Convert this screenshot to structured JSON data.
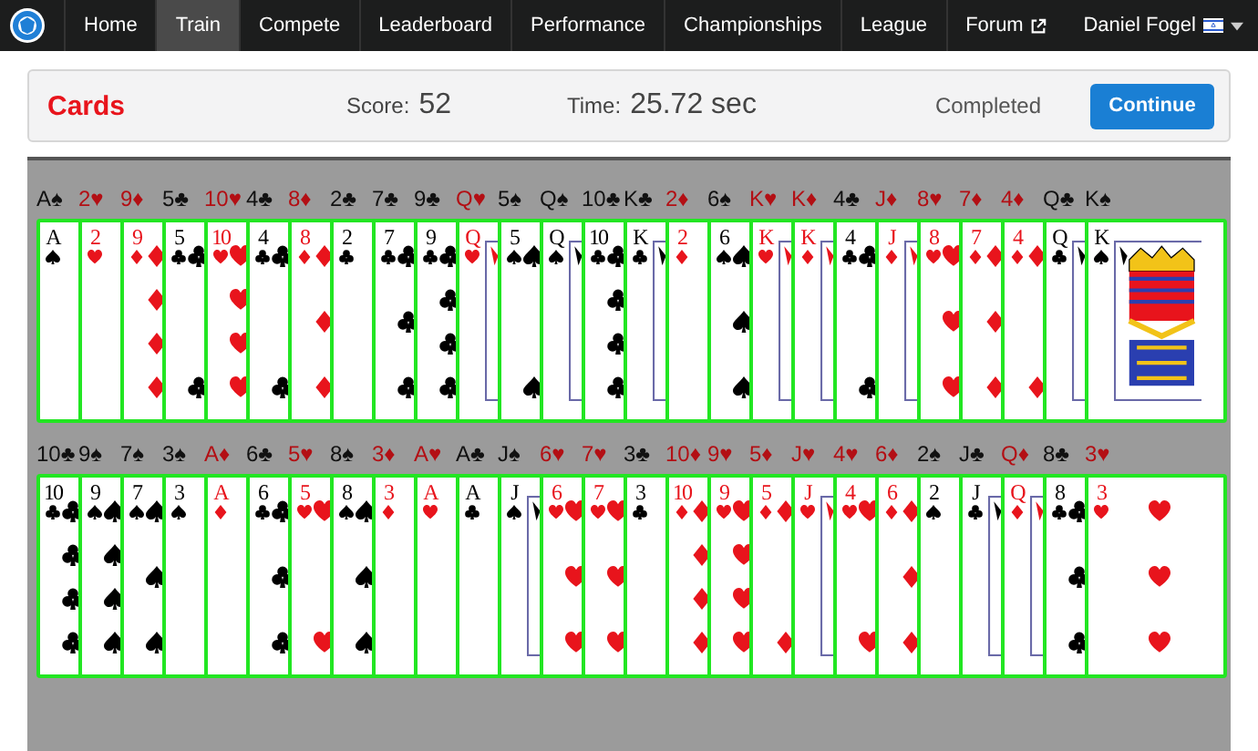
{
  "nav": {
    "items": [
      {
        "label": "Home",
        "selected": false
      },
      {
        "label": "Train",
        "selected": true
      },
      {
        "label": "Compete",
        "selected": false
      },
      {
        "label": "Leaderboard",
        "selected": false
      },
      {
        "label": "Performance",
        "selected": false
      },
      {
        "label": "Championships",
        "selected": false
      },
      {
        "label": "League",
        "selected": false
      },
      {
        "label": "Forum",
        "selected": false,
        "external": true
      }
    ],
    "user": "Daniel Fogel"
  },
  "result": {
    "title": "Cards",
    "score_label": "Score:",
    "score": "52",
    "time_label": "Time:",
    "time": "25.72 sec",
    "status": "Completed",
    "button": "Continue"
  },
  "rows": [
    {
      "cards": [
        {
          "label": "A♠",
          "rank": "A",
          "kind": "spades",
          "correct": true
        },
        {
          "label": "2♥",
          "rank": "2",
          "kind": "hearts",
          "correct": true
        },
        {
          "label": "9♦",
          "rank": "9",
          "kind": "diamonds",
          "correct": true
        },
        {
          "label": "5♣",
          "rank": "5",
          "kind": "clubs",
          "correct": true
        },
        {
          "label": "10♥",
          "rank": "10",
          "kind": "hearts",
          "correct": true
        },
        {
          "label": "4♣",
          "rank": "4",
          "kind": "clubs",
          "correct": true
        },
        {
          "label": "8♦",
          "rank": "8",
          "kind": "diamonds",
          "correct": true
        },
        {
          "label": "2♣",
          "rank": "2",
          "kind": "clubs",
          "correct": true
        },
        {
          "label": "7♣",
          "rank": "7",
          "kind": "clubs",
          "correct": true
        },
        {
          "label": "9♣",
          "rank": "9",
          "kind": "clubs",
          "correct": true
        },
        {
          "label": "Q♥",
          "rank": "Q",
          "kind": "hearts",
          "correct": true
        },
        {
          "label": "5♠",
          "rank": "5",
          "kind": "spades",
          "correct": true
        },
        {
          "label": "Q♠",
          "rank": "Q",
          "kind": "spades",
          "correct": true
        },
        {
          "label": "10♣",
          "rank": "10",
          "kind": "clubs",
          "correct": true
        },
        {
          "label": "K♣",
          "rank": "K",
          "kind": "clubs",
          "correct": true
        },
        {
          "label": "2♦",
          "rank": "2",
          "kind": "diamonds",
          "correct": true
        },
        {
          "label": "6♠",
          "rank": "6",
          "kind": "spades",
          "correct": true
        },
        {
          "label": "K♥",
          "rank": "K",
          "kind": "hearts",
          "correct": true
        },
        {
          "label": "K♦",
          "rank": "K",
          "kind": "diamonds",
          "correct": true
        },
        {
          "label": "4♣",
          "rank": "4",
          "kind": "clubs",
          "correct": true
        },
        {
          "label": "J♦",
          "rank": "J",
          "kind": "diamonds",
          "correct": true
        },
        {
          "label": "8♥",
          "rank": "8",
          "kind": "hearts",
          "correct": true
        },
        {
          "label": "7♦",
          "rank": "7",
          "kind": "diamonds",
          "correct": true
        },
        {
          "label": "4♦",
          "rank": "4",
          "kind": "diamonds",
          "correct": true
        },
        {
          "label": "Q♣",
          "rank": "Q",
          "kind": "clubs",
          "correct": true
        },
        {
          "label": "K♠",
          "rank": "K",
          "kind": "spades",
          "correct": true
        }
      ]
    },
    {
      "cards": [
        {
          "label": "10♣",
          "rank": "10",
          "kind": "clubs",
          "correct": true
        },
        {
          "label": "9♠",
          "rank": "9",
          "kind": "spades",
          "correct": true
        },
        {
          "label": "7♠",
          "rank": "7",
          "kind": "spades",
          "correct": true
        },
        {
          "label": "3♠",
          "rank": "3",
          "kind": "spades",
          "correct": true
        },
        {
          "label": "A♦",
          "rank": "A",
          "kind": "diamonds",
          "correct": true
        },
        {
          "label": "6♣",
          "rank": "6",
          "kind": "clubs",
          "correct": true
        },
        {
          "label": "5♥",
          "rank": "5",
          "kind": "hearts",
          "correct": true
        },
        {
          "label": "8♠",
          "rank": "8",
          "kind": "spades",
          "correct": true
        },
        {
          "label": "3♦",
          "rank": "3",
          "kind": "diamonds",
          "correct": true
        },
        {
          "label": "A♥",
          "rank": "A",
          "kind": "hearts",
          "correct": true
        },
        {
          "label": "A♣",
          "rank": "A",
          "kind": "clubs",
          "correct": true
        },
        {
          "label": "J♠",
          "rank": "J",
          "kind": "spades",
          "correct": true
        },
        {
          "label": "6♥",
          "rank": "6",
          "kind": "hearts",
          "correct": true
        },
        {
          "label": "7♥",
          "rank": "7",
          "kind": "hearts",
          "correct": true
        },
        {
          "label": "3♣",
          "rank": "3",
          "kind": "clubs",
          "correct": true
        },
        {
          "label": "10♦",
          "rank": "10",
          "kind": "diamonds",
          "correct": true
        },
        {
          "label": "9♥",
          "rank": "9",
          "kind": "hearts",
          "correct": true
        },
        {
          "label": "5♦",
          "rank": "5",
          "kind": "diamonds",
          "correct": true
        },
        {
          "label": "J♥",
          "rank": "J",
          "kind": "hearts",
          "correct": true
        },
        {
          "label": "4♥",
          "rank": "4",
          "kind": "hearts",
          "correct": true
        },
        {
          "label": "6♦",
          "rank": "6",
          "kind": "diamonds",
          "correct": true
        },
        {
          "label": "2♠",
          "rank": "2",
          "kind": "spades",
          "correct": true
        },
        {
          "label": "J♣",
          "rank": "J",
          "kind": "clubs",
          "correct": true
        },
        {
          "label": "Q♦",
          "rank": "Q",
          "kind": "diamonds",
          "correct": true
        },
        {
          "label": "8♣",
          "rank": "8",
          "kind": "clubs",
          "correct": true
        },
        {
          "label": "3♥",
          "rank": "3",
          "kind": "hearts",
          "correct": true
        }
      ]
    }
  ]
}
